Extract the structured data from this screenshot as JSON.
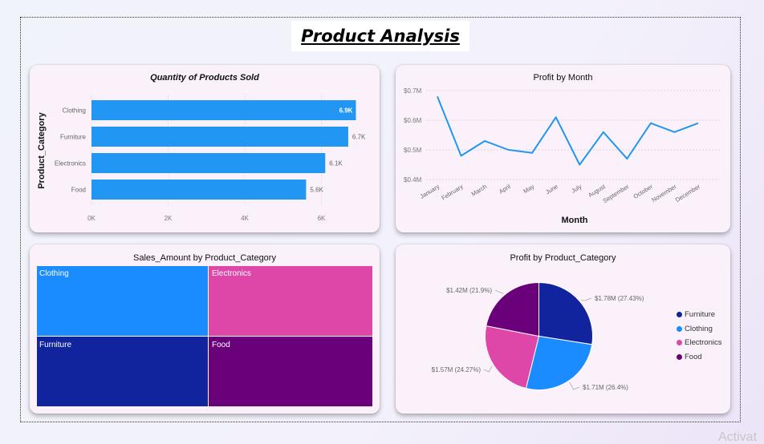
{
  "page": {
    "title": "Product Analysis",
    "watermark": "Activat"
  },
  "cards": {
    "qty": {
      "title": "Quantity of Products Sold",
      "y_label": "Product_Category"
    },
    "profit_month": {
      "title": "Profit by Month",
      "x_label": "Month"
    },
    "treemap": {
      "title": "Sales_Amount by Product_Category"
    },
    "pie": {
      "title": "Profit by Product_Category"
    }
  },
  "colors": {
    "bar_blue": "#2196f3",
    "line_blue": "#2196f3",
    "clothing": "#1a8cff",
    "electronics": "#de47a8",
    "furniture": "#12239e",
    "food": "#6b007b"
  },
  "chart_data": [
    {
      "type": "bar",
      "title": "Quantity of Products Sold",
      "ylabel": "Product_Category",
      "categories": [
        "Clothing",
        "Furniture",
        "Electronics",
        "Food"
      ],
      "values": [
        6900,
        6700,
        6100,
        5600
      ],
      "data_labels": [
        "6.9K",
        "6.7K",
        "6.1K",
        "5.6K"
      ],
      "xticks": [
        "0K",
        "2K",
        "4K",
        "6K"
      ],
      "xlim": [
        0,
        7000
      ],
      "grid": true
    },
    {
      "type": "line",
      "title": "Profit by Month",
      "xlabel": "Month",
      "categories": [
        "January",
        "February",
        "March",
        "April",
        "May",
        "June",
        "July",
        "August",
        "September",
        "October",
        "November",
        "December"
      ],
      "values": [
        0.68,
        0.48,
        0.53,
        0.5,
        0.49,
        0.61,
        0.45,
        0.56,
        0.47,
        0.59,
        0.56,
        0.59
      ],
      "yticks": [
        "$0.7M",
        "$0.6M",
        "$0.5M",
        "$0.4M"
      ],
      "ylim": [
        0.4,
        0.7
      ],
      "grid": true
    },
    {
      "type": "treemap",
      "title": "Sales_Amount by Product_Category",
      "categories": [
        "Clothing",
        "Electronics",
        "Furniture",
        "Food"
      ]
    },
    {
      "type": "pie",
      "title": "Profit by Product_Category",
      "slices": [
        {
          "name": "Furniture",
          "value": 1.78,
          "label": "$1.78M (27.43%)"
        },
        {
          "name": "Clothing",
          "value": 1.71,
          "label": "$1.71M (26.4%)"
        },
        {
          "name": "Electronics",
          "value": 1.57,
          "label": "$1.57M (24.27%)"
        },
        {
          "name": "Food",
          "value": 1.42,
          "label": "$1.42M (21.9%)"
        }
      ],
      "legend": [
        "Furniture",
        "Clothing",
        "Electronics",
        "Food"
      ],
      "legend_position": "right"
    }
  ]
}
